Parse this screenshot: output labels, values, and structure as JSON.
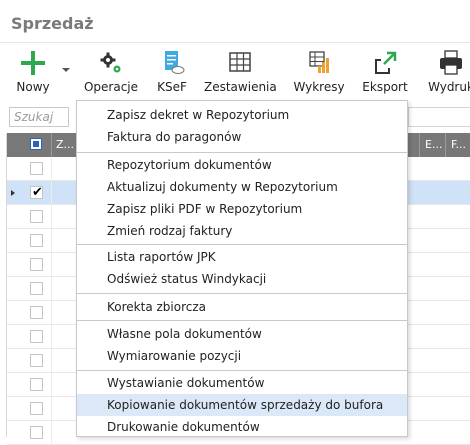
{
  "window": {
    "title": "Sprzedaż"
  },
  "toolbar": {
    "new_label": "Nowy",
    "operations_label": "Operacje",
    "ksef_label": "KSeF",
    "reports_label": "Zestawienia",
    "charts_label": "Wykresy",
    "export_label": "Eksport",
    "print_label": "Wydruk"
  },
  "search": {
    "placeholder": "Szukaj"
  },
  "grid": {
    "headers": [
      "Z...",
      "E...",
      "F..."
    ],
    "selected_row": 1
  },
  "menu": {
    "items": [
      "Zapisz dekret w Repozytorium",
      "Faktura do paragonów",
      "Repozytorium dokumentów",
      "Aktualizuj dokumenty w Repozytorium",
      "Zapisz pliki PDF w Repozytorium",
      "Zmień rodzaj faktury",
      "Lista raportów JPK",
      "Odśwież status Windykacji",
      "Korekta zbiorcza",
      "Własne pola dokumentów",
      "Wymiarowanie pozycji",
      "Wystawianie dokumentów",
      "Kopiowanie dokumentów sprzedaży do bufora",
      "Drukowanie dokumentów"
    ],
    "highlighted_index": 12
  },
  "colors": {
    "accent_green": "#2fa84f",
    "grid_header": "#787878",
    "selected_row": "#cfe2f8",
    "menu_highlight": "#dbe8f7"
  }
}
